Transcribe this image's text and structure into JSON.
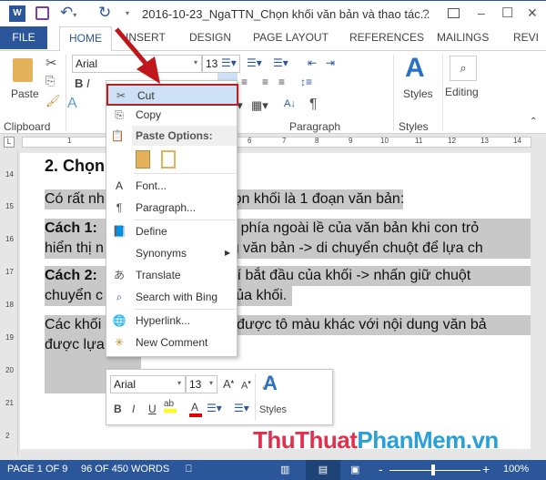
{
  "title": "2016-10-23_NgaTTN_Chọn khối văn bản và thao tác...",
  "window_controls": {
    "help": "?",
    "minimize": "–",
    "maximize": "☐",
    "close": "✕"
  },
  "tabs": [
    "FILE",
    "HOME",
    "INSERT",
    "DESIGN",
    "PAGE LAYOUT",
    "REFERENCES",
    "MAILINGS",
    "REVI"
  ],
  "ribbon": {
    "paste": "Paste",
    "font": "Arial",
    "size": "13",
    "clipboard": "Clipboard",
    "paragraph": "Paragraph",
    "styles": "Styles",
    "styles_group": "Styles",
    "editing": "Editing",
    "bold": "B",
    "italic": "I"
  },
  "ruler_ticks": [
    "1",
    "6",
    "7",
    "8",
    "9",
    "10",
    "11",
    "12",
    "13",
    "14"
  ],
  "vruler_ticks": [
    "14",
    "15",
    "16",
    "17",
    "18",
    "19",
    "20",
    "21",
    "2"
  ],
  "document": {
    "heading": "2. Chọn",
    "lines": [
      {
        "left": "Có rất nh",
        "right": "ra chọn khối là 1 đoạn văn bản:"
      },
      {
        "bold": "Cách 1:",
        "right": "ột sát phía ngoài lề của văn bản khi con trỏ"
      },
      {
        "left": "hiển thị n",
        "right": "dòng văn bản -> di chuyển chuột để lựa ch"
      },
      {
        "bold": "Cách 2:",
        "right": "ại ví trí bắt đầu của khối -> nhấn giữ chuột"
      },
      {
        "left": "chuyển c",
        "right": "húc của khối."
      },
      {
        "left": "Các khối",
        "right": "ũng được tô màu khác với nội dung văn bả"
      },
      {
        "left": "được lựa"
      }
    ]
  },
  "context_menu": {
    "items": [
      {
        "label": "Cut",
        "icon": "scissors-icon"
      },
      {
        "label": "Copy",
        "icon": "copy-icon"
      },
      {
        "label": "Paste Options:",
        "icon": "paste-icon"
      },
      {
        "label": "Font...",
        "icon": "font-icon"
      },
      {
        "label": "Paragraph...",
        "icon": "paragraph-icon"
      },
      {
        "label": "Define",
        "icon": "define-icon"
      },
      {
        "label": "Synonyms",
        "icon": ""
      },
      {
        "label": "Translate",
        "icon": "translate-icon"
      },
      {
        "label": "Search with Bing",
        "icon": "search-icon"
      },
      {
        "label": "Hyperlink...",
        "icon": "hyperlink-icon"
      },
      {
        "label": "New Comment",
        "icon": "comment-icon"
      }
    ]
  },
  "mini_toolbar": {
    "font": "Arial",
    "size": "13",
    "bold": "B",
    "italic": "I",
    "underline": "U",
    "styles": "Styles",
    "highlight_color": "#ffff00",
    "font_color": "#e00000"
  },
  "status": {
    "page": "PAGE 1 OF 9",
    "words": "96 OF 450 WORDS",
    "zoom": "100%",
    "zoom_level": 100
  },
  "watermark": {
    "part1": "ThuThuat",
    "part2": "PhanMem",
    "part3": ".vn"
  },
  "colors": {
    "accent": "#2b579a",
    "selection": "#c8c8c8",
    "highlight_border": "#b22222"
  }
}
